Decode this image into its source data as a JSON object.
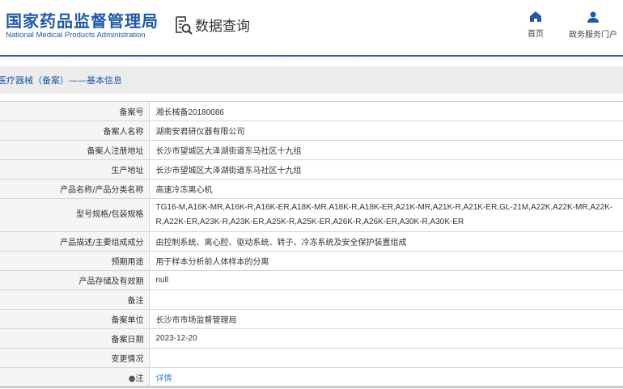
{
  "header": {
    "logo_cn": "国家药品监督管理局",
    "logo_en": "National Medical Products Administration",
    "section_title": "数据查询",
    "nav": [
      {
        "label": "首页",
        "icon": "home-icon"
      },
      {
        "label": "政务服务门户",
        "icon": "user-icon"
      }
    ]
  },
  "section": {
    "title": "医疗器械（备案）——基本信息"
  },
  "rows": [
    {
      "label": "备案号",
      "value": "湘长械备20180086"
    },
    {
      "label": "备案人名称",
      "value": "湖南安君研仪器有限公司"
    },
    {
      "label": "备案人注册地址",
      "value": "长沙市望城区大泽湖街道东马社区十九组"
    },
    {
      "label": "生产地址",
      "value": "长沙市望城区大泽湖街道东马社区十九组"
    },
    {
      "label": "产品名称/产品分类名称",
      "value": "高速冷冻离心机"
    },
    {
      "label": "型号规格/包装规格",
      "value": "TG16-M,A16K-MR,A16K-R,A16K-ER,A18K-MR,A18K-R,A18K-ER,A21K-MR,A21K-R,A21K-ER,GL-21M,A22K,A22K-MR,A22K-R,A22K-ER,A23K-R,A23K-ER,A25K-R,A25K-ER,A26K-R,A26K-ER,A30K-R,A30K-ER"
    },
    {
      "label": "产品描述/主要组成成分",
      "value": "由控制系统、离心腔、驱动系统、转子、冷冻系统及安全保护装置组成"
    },
    {
      "label": "预期用途",
      "value": "用于样本分析前人体样本的分离"
    },
    {
      "label": "产品存储及有效期",
      "value": "null"
    },
    {
      "label": "备注",
      "value": ""
    },
    {
      "label": "备案单位",
      "value": "长沙市市场监督管理局"
    },
    {
      "label": "备案日期",
      "value": "2023-12-20"
    },
    {
      "label": "变更情况",
      "value": ""
    }
  ],
  "note": {
    "label": "注",
    "link": "详情"
  }
}
